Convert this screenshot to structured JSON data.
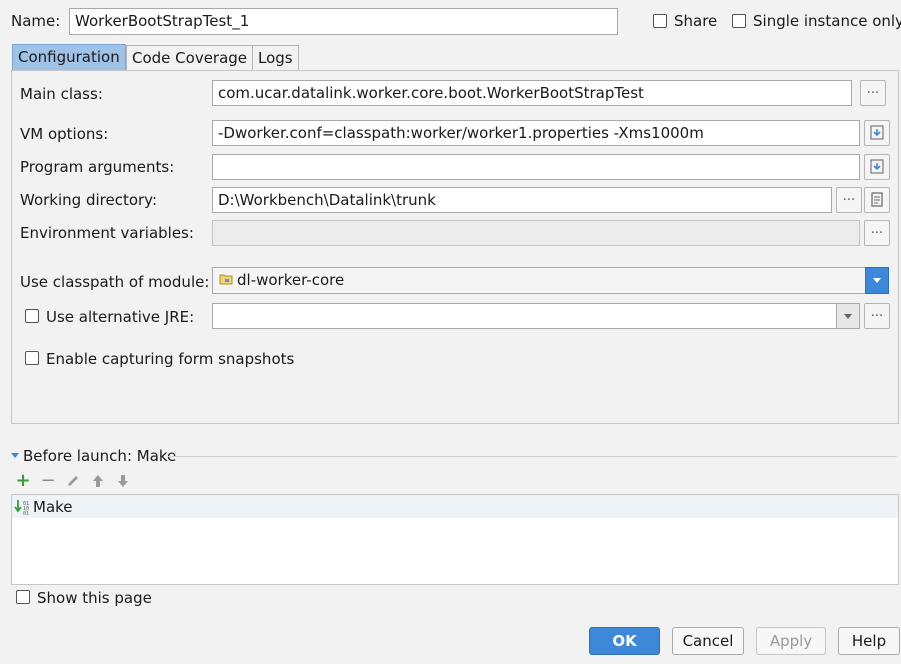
{
  "header": {
    "name_label": "Name:",
    "name_value": "WorkerBootStrapTest_1",
    "share_label": "Share",
    "single_instance_label": "Single instance only"
  },
  "tabs": [
    {
      "label": "Configuration",
      "active": true
    },
    {
      "label": "Code Coverage",
      "active": false
    },
    {
      "label": "Logs",
      "active": false
    }
  ],
  "config": {
    "main_class_label": "Main class:",
    "main_class_value": "com.ucar.datalink.worker.core.boot.WorkerBootStrapTest",
    "vm_options_label": "VM options:",
    "vm_options_value": "-Dworker.conf=classpath:worker/worker1.properties -Xms1000m",
    "program_args_label": "Program arguments:",
    "program_args_value": "",
    "working_dir_label": "Working directory:",
    "working_dir_value": "D:\\Workbench\\Datalink\\trunk",
    "env_vars_label": "Environment variables:",
    "env_vars_value": "",
    "classpath_label": "Use classpath of module:",
    "classpath_value": "dl-worker-core",
    "alt_jre_label": "Use alternative JRE:",
    "alt_jre_value": "",
    "snapshots_label": "Enable capturing form snapshots",
    "dots": "..."
  },
  "before_launch": {
    "title": "Before launch: Make",
    "items": [
      {
        "label": "Make"
      }
    ]
  },
  "footer": {
    "show_page_label": "Show this page",
    "ok": "OK",
    "cancel": "Cancel",
    "apply": "Apply",
    "help": "Help"
  },
  "colors": {
    "primary_button": "#3e88da",
    "active_tab": "#9fc2e7",
    "dropdown_arrow": "#3e88da",
    "add_icon": "#3a9a3a"
  }
}
